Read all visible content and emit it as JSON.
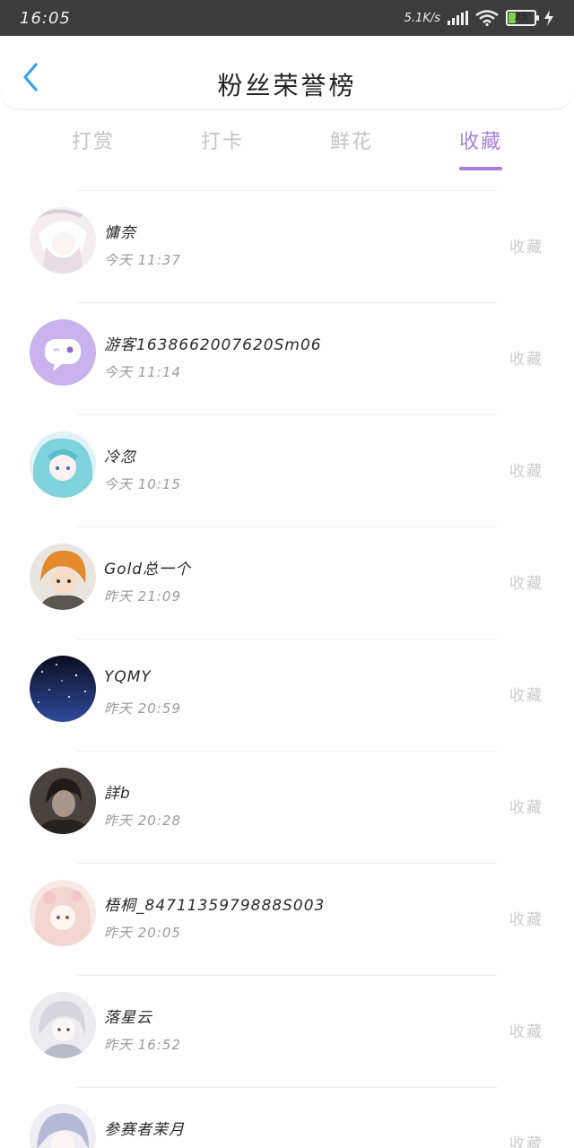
{
  "status_bar": {
    "time": "16:05",
    "network_speed": "5.1K/s",
    "battery_level": "25"
  },
  "header": {
    "title": "粉丝荣誉榜"
  },
  "tabs": [
    {
      "label": "打赏",
      "active": false
    },
    {
      "label": "打卡",
      "active": false
    },
    {
      "label": "鲜花",
      "active": false
    },
    {
      "label": "收藏",
      "active": true
    }
  ],
  "colors": {
    "accent": "#a682d8",
    "tab_inactive": "#c4c4c4",
    "status_bar_bg": "#3c3c3c",
    "back_icon": "#3a9ee8"
  },
  "fans": [
    {
      "name": "慵奈",
      "time": "今天 11:37",
      "action": "收藏",
      "avatar": "anime-white-hair-avatar"
    },
    {
      "name": "游客1638662007620Sm06",
      "time": "今天 11:14",
      "action": "收藏",
      "avatar": "default-chat-avatar"
    },
    {
      "name": "冷忽",
      "time": "今天 10:15",
      "action": "收藏",
      "avatar": "anime-teal-hair-avatar"
    },
    {
      "name": "Gold总一个",
      "time": "昨天 21:09",
      "action": "收藏",
      "avatar": "anime-orange-hair-avatar"
    },
    {
      "name": "YQMY",
      "time": "昨天 20:59",
      "action": "收藏",
      "avatar": "starry-sky-avatar"
    },
    {
      "name": "詳b",
      "time": "昨天 20:28",
      "action": "收藏",
      "avatar": "dark-photo-avatar"
    },
    {
      "name": "梧桐_8471135979888S003",
      "time": "昨天 20:05",
      "action": "收藏",
      "avatar": "anime-pink-hair-avatar"
    },
    {
      "name": "落星云",
      "time": "昨天 16:52",
      "action": "收藏",
      "avatar": "anime-silver-hair-avatar"
    },
    {
      "name": "参赛者茉月",
      "time": "",
      "action": "收藏",
      "avatar": "anime-lavender-hair-avatar"
    }
  ]
}
